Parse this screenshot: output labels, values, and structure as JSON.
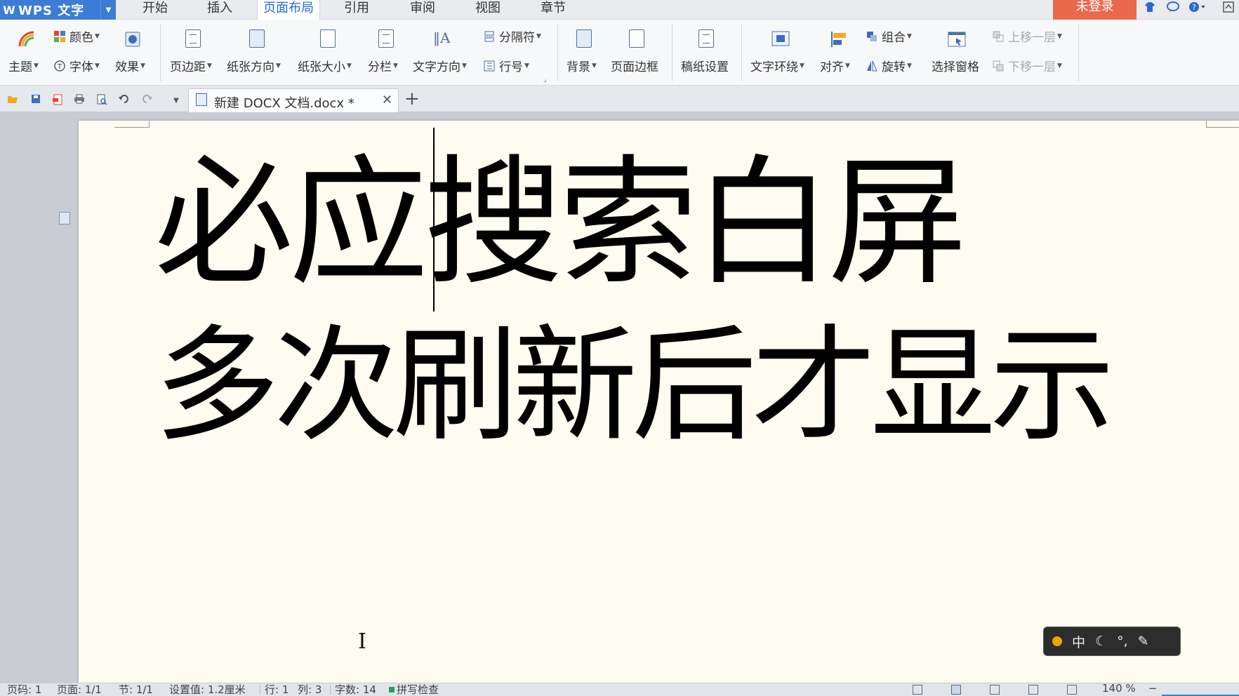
{
  "app": {
    "logo": "W",
    "name": "WPS 文字"
  },
  "menu": {
    "tabs": [
      {
        "label": "开始"
      },
      {
        "label": "插入"
      },
      {
        "label": "页面布局",
        "active": true
      },
      {
        "label": "引用"
      },
      {
        "label": "审阅"
      },
      {
        "label": "视图"
      },
      {
        "label": "章节"
      }
    ],
    "login": "未登录"
  },
  "ribbon": {
    "theme": "主题",
    "color": "颜色",
    "font": "字体",
    "effect": "效果",
    "margins": "页边距",
    "orientation": "纸张方向",
    "size": "纸张大小",
    "columns": "分栏",
    "text_direction": "文字方向",
    "breaks": "分隔符",
    "line_numbers": "行号",
    "background": "背景",
    "page_border": "页面边框",
    "manuscript": "稿纸设置",
    "wrap": "文字环绕",
    "align": "对齐",
    "group": "组合",
    "rotate": "旋转",
    "selection_pane": "选择窗格",
    "bring_forward": "上移一层",
    "send_backward": "下移一层"
  },
  "document": {
    "tab_name": "新建 DOCX 文档.docx *",
    "line1": "必应搜索白屏",
    "line2": "多次刷新后才显示"
  },
  "ime": {
    "mode": "中"
  },
  "status": {
    "page": "页码: 1",
    "pages": "页面: 1/1",
    "section": "节: 1/1",
    "setting": "设置值: 1.2厘米",
    "row": "行: 1",
    "col": "列: 3",
    "word_count": "字数: 14",
    "spellcheck": "拼写检查",
    "zoom": "140 %"
  },
  "colors": {
    "accent": "#3b7cd6",
    "login": "#e9694c",
    "page": "#fefbf0",
    "workspace": "#c9ccd3"
  }
}
